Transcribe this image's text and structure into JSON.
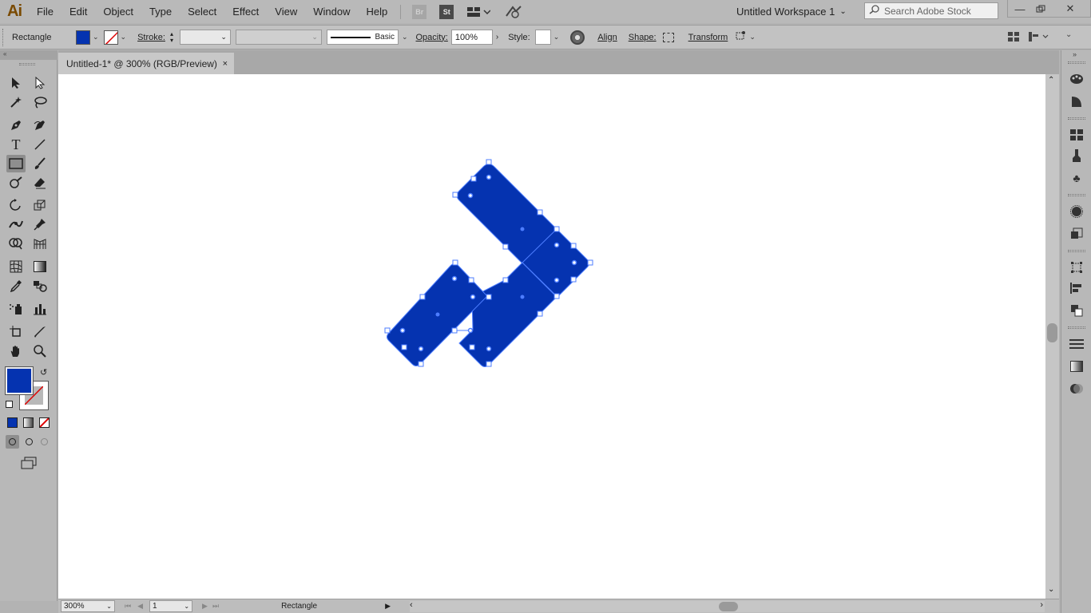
{
  "app": {
    "logo": "Ai"
  },
  "menu": {
    "items": [
      "File",
      "Edit",
      "Object",
      "Type",
      "Select",
      "Effect",
      "View",
      "Window",
      "Help"
    ],
    "bridge": "Br",
    "stock": "St",
    "workspace": "Untitled Workspace 1",
    "search_placeholder": "Search Adobe Stock"
  },
  "control": {
    "selection": "Rectangle",
    "stroke_label": "Stroke:",
    "brush": "Basic",
    "opacity_label": "Opacity:",
    "opacity_value": "100%",
    "style_label": "Style:",
    "align_label": "Align",
    "shape_label": "Shape:",
    "transform_label": "Transform"
  },
  "document": {
    "tab_title": "Untitled-1* @ 300% (RGB/Preview)",
    "close_glyph": "×"
  },
  "status": {
    "zoom": "300%",
    "artboard": "1",
    "current_tool": "Rectangle"
  },
  "colors": {
    "fill": "#0533b0",
    "selection": "#4d7dff",
    "stroke": "none"
  }
}
